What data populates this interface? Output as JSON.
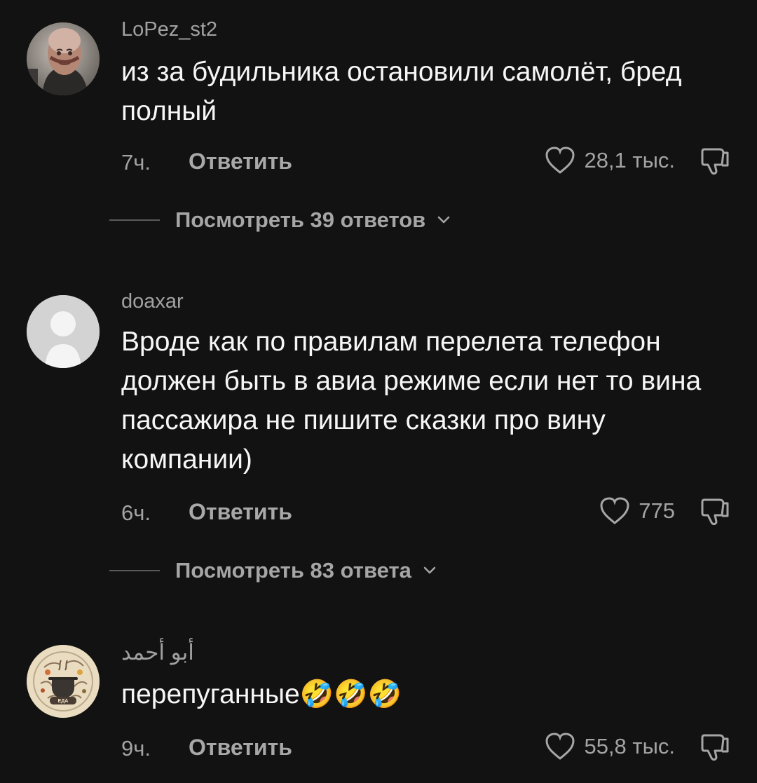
{
  "comments": [
    {
      "username": "LoPez_st2",
      "text": "из за будильника остановили самолёт, бред полный",
      "time": "7ч.",
      "reply": "Ответить",
      "likes": "28,1 тыс.",
      "view_replies": "Посмотреть 39 ответов"
    },
    {
      "username": "doaxar",
      "text": "Вроде как по правилам перелета телефон должен быть в авиа режиме если нет то вина пассажира не пишите сказки про вину компании)",
      "time": "6ч.",
      "reply": "Ответить",
      "likes": "775",
      "view_replies": "Посмотреть 83 ответа"
    },
    {
      "username": "أبو أحمد",
      "text": "перепуганные🤣🤣🤣",
      "time": "9ч.",
      "reply": "Ответить",
      "likes": "55,8 тыс.",
      "logo_text": "EДA"
    }
  ],
  "icons": {
    "heart": "heart-icon",
    "dislike": "dislike-icon",
    "chevron": "chevron-down-icon"
  },
  "colors": {
    "background": "#121212",
    "text": "#f6f6f6",
    "muted": "#a3a3a3"
  }
}
